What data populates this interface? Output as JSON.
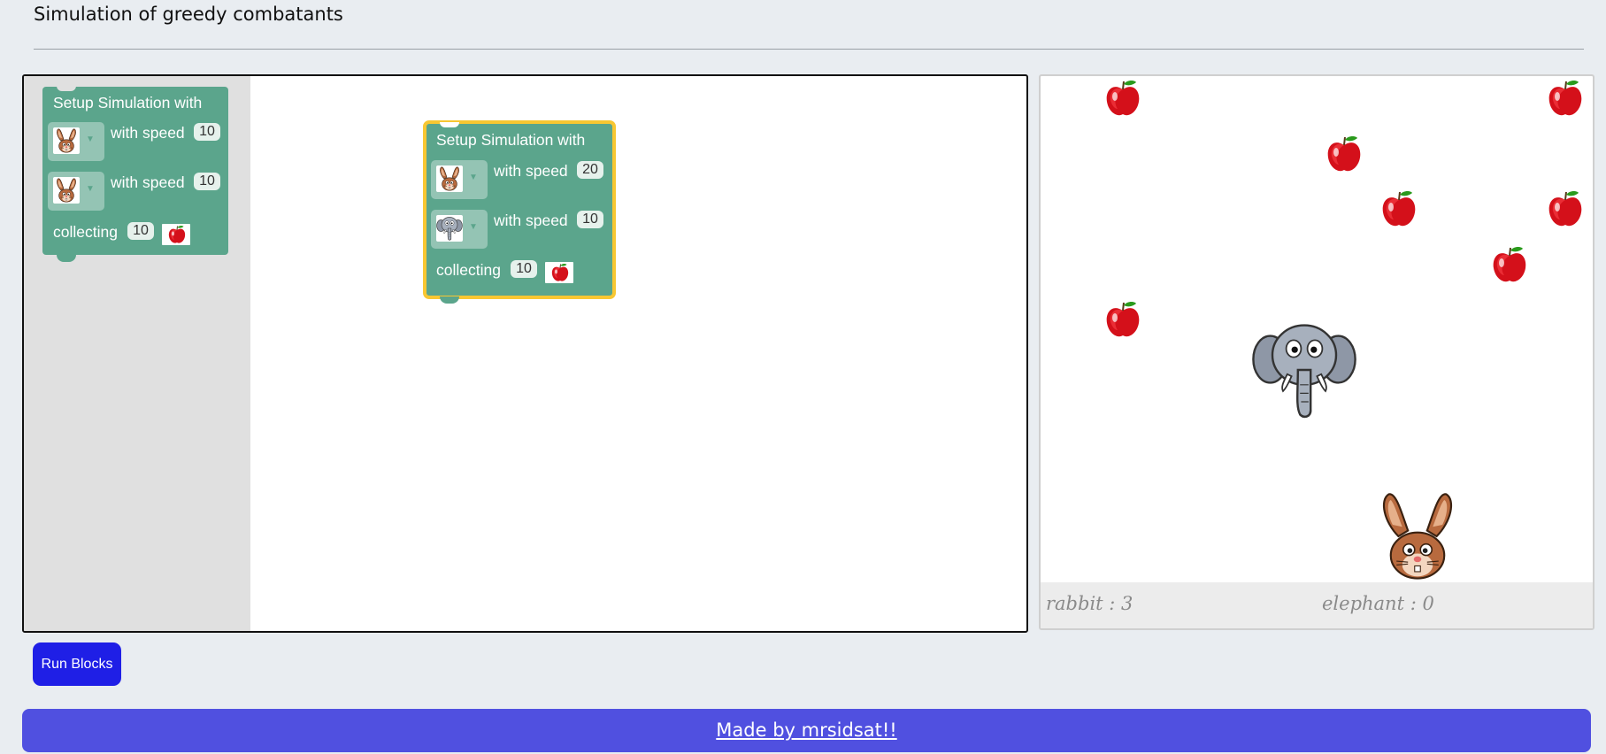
{
  "page": {
    "title": "Simulation of greedy combatants"
  },
  "toolbox_block": {
    "header": "Setup Simulation with",
    "row1": {
      "animal": "rabbit",
      "label": "with speed",
      "speed": "10"
    },
    "row2": {
      "animal": "rabbit",
      "label": "with speed",
      "speed": "10"
    },
    "collect": {
      "label": "collecting",
      "count": "10",
      "item": "apple"
    }
  },
  "workspace_block": {
    "header": "Setup Simulation with",
    "row1": {
      "animal": "rabbit",
      "label": "with speed",
      "speed": "20"
    },
    "row2": {
      "animal": "elephant",
      "label": "with speed",
      "speed": "10"
    },
    "collect": {
      "label": "collecting",
      "count": "10",
      "item": "apple"
    }
  },
  "simulation": {
    "sprites": [
      "apple-icon",
      "rabbit-icon",
      "elephant-icon"
    ],
    "apple_count": 7,
    "scores": {
      "rabbit": "rabbit : 3",
      "elephant": "elephant : 0"
    }
  },
  "controls": {
    "run_label": "Run Blocks"
  },
  "footer": {
    "text": "Made by mrsidsat!!"
  },
  "colors": {
    "block": "#5ba58c",
    "selected_outline": "#f8c732",
    "run_button": "#1f1fe6",
    "footer": "#5050e0"
  }
}
